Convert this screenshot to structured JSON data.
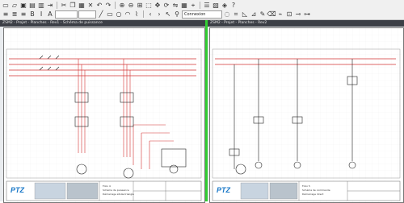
{
  "toolbar": {
    "row1_icons": [
      "new-file-icon",
      "open-folder-icon",
      "save-icon",
      "save-all-icon",
      "print-icon",
      "export-icon",
      "cut-icon",
      "copy-icon",
      "paste-icon",
      "delete-icon",
      "undo-icon",
      "redo-icon",
      "zoom-in-icon",
      "zoom-out-icon",
      "zoom-fit-icon",
      "select-icon",
      "move-icon",
      "rotate-icon",
      "mirror-icon",
      "grid-icon",
      "snap-icon",
      "properties-icon",
      "parts-icon",
      "lock-icon",
      "help-icon"
    ],
    "row2_icons": [
      "align-left-icon",
      "align-center-icon",
      "align-right-icon",
      "bold-icon",
      "italic-icon",
      "text-icon",
      "line-icon",
      "rectangle-icon",
      "circle-icon",
      "arc-icon",
      "polyline-icon",
      "nav-back-icon",
      "nav-forward-icon",
      "pointer-icon",
      "pin-icon",
      "lasso-icon",
      "crop-icon",
      "triangle-icon",
      "measure-icon",
      "pencil-icon",
      "eraser-icon",
      "wire-icon",
      "symbol-icon",
      "connect-icon",
      "terminal-icon"
    ],
    "zoom_select": "",
    "layer_select": "",
    "mode_select": "Connexion"
  },
  "tabs": {
    "left": "ZSM2 - Projet - Planches - Rev1 - Schéma de puissance",
    "right": "ZSM2 - Projet - Planches - Rev2"
  },
  "sheets": {
    "left": {
      "logo": "PTZ",
      "title_lines": [
        "Folio 4",
        "Schéma de puissance",
        "Démarrage étoile-triangle"
      ]
    },
    "right": {
      "logo": "PTZ",
      "title_lines": [
        "Folio 5",
        "Schéma de commande",
        "Démarrage direct"
      ]
    }
  },
  "colors": {
    "toolbar_bg": "#f0f0f0",
    "tab_bg": "#3c3f46",
    "divider": "#33cc33",
    "wire_red": "#d33333",
    "accent_blue": "#1b79c8"
  }
}
